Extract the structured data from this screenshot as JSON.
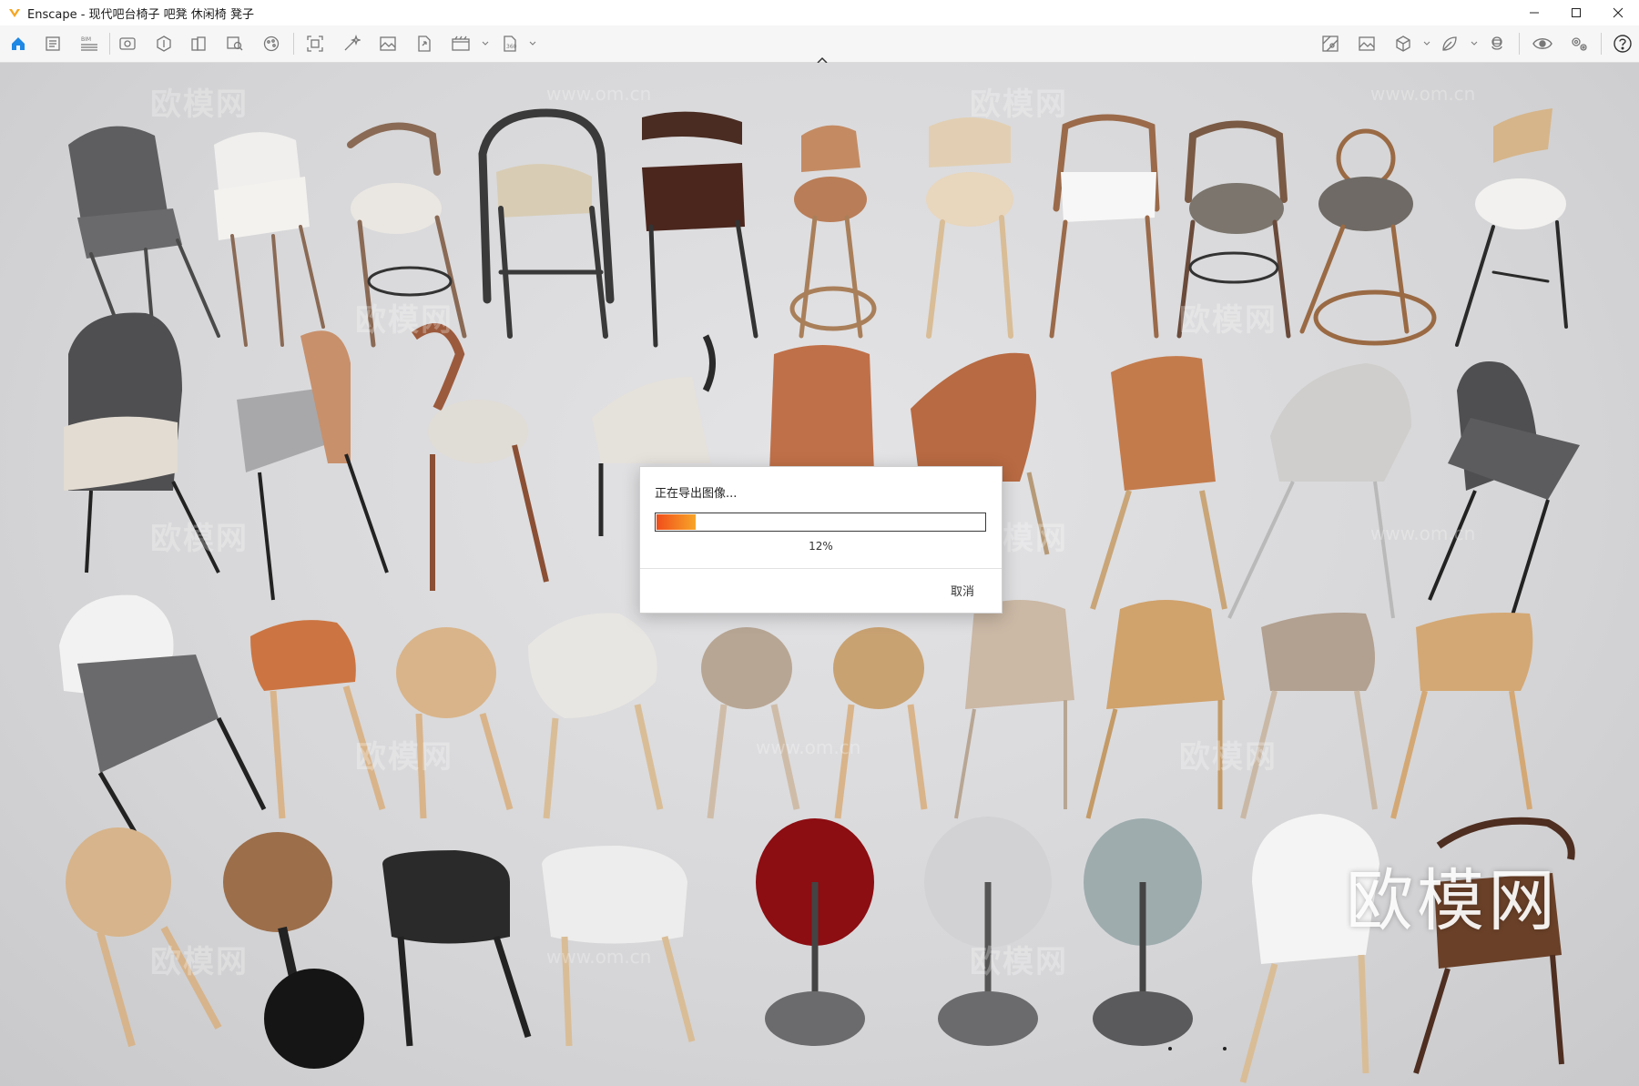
{
  "window": {
    "title": "Enscape - 现代吧台椅子 吧凳 休闲椅 凳子",
    "controls": [
      "minimize-icon",
      "maximize-icon",
      "close-icon"
    ]
  },
  "toolbar": {
    "left_icons": [
      "home-icon",
      "document-icon",
      "bim-list-icon",
      "view-icon",
      "asset-icon",
      "building-icon",
      "inspect-icon",
      "palette-icon",
      "screenshot-icon",
      "magic-icon",
      "image-icon",
      "export-icon",
      "video-icon",
      "panorama-icon"
    ],
    "right_icons": [
      "map-icon",
      "gallery-icon",
      "cube-icon",
      "leaf-icon",
      "vr-headset-icon",
      "eye-icon",
      "settings-icon",
      "help-icon"
    ],
    "accent": "#1e88e5"
  },
  "scene": {
    "watermarks": [
      "欧模网",
      "www.om.cn"
    ],
    "brand_overlay": "欧模网",
    "background": "#d9d9db"
  },
  "dialog": {
    "title": "正在导出图像...",
    "progress": 0.12,
    "progress_text": "12%",
    "cancel_label": "取消",
    "colors": {
      "fill_start": "#f04e1a",
      "fill_end": "#f7a528"
    }
  }
}
